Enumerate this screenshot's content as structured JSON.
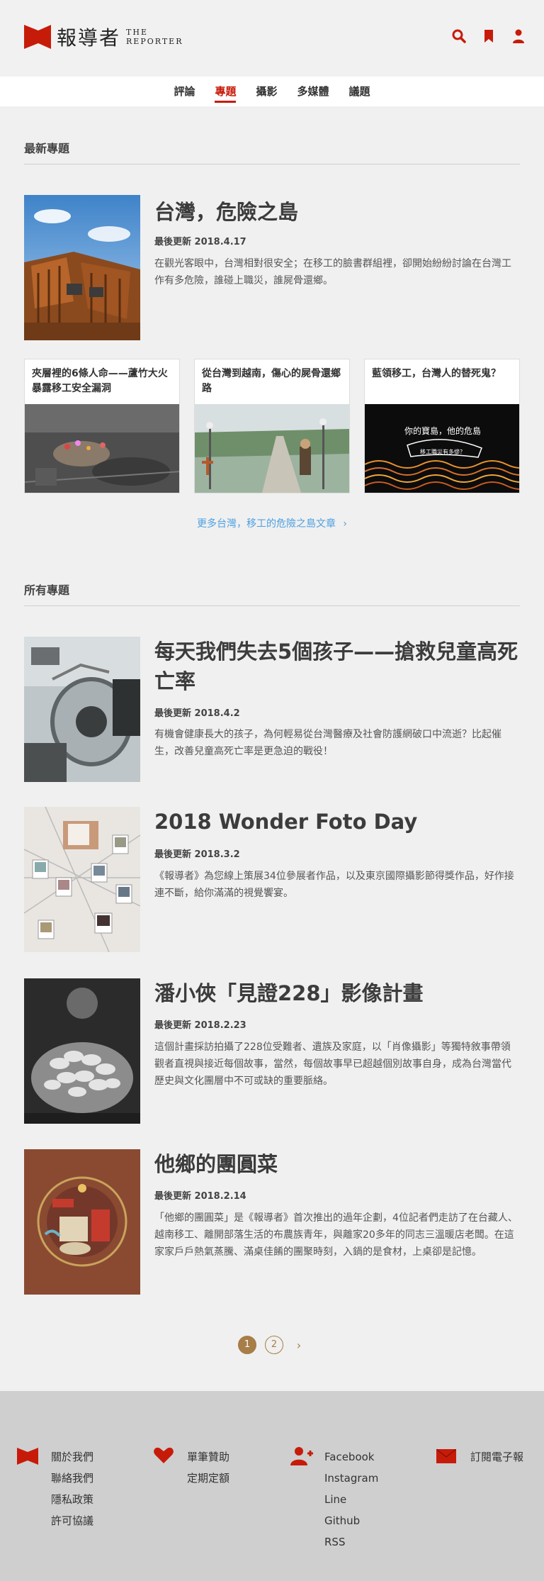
{
  "header": {
    "logo_cn": "報導者",
    "logo_en_line1": "THE",
    "logo_en_line2": "REPORTER",
    "colors": {
      "brand_red": "#c71b0a",
      "link_blue": "#4da0e0",
      "pager_gold": "#a77d48"
    },
    "icons": [
      "search-icon",
      "bookmark-icon",
      "user-icon"
    ]
  },
  "nav": {
    "items": [
      {
        "label": "評論"
      },
      {
        "label": "專題"
      },
      {
        "label": "攝影"
      },
      {
        "label": "多媒體"
      },
      {
        "label": "議題"
      }
    ],
    "active": "專題"
  },
  "latest": {
    "section_title": "最新專題",
    "featured": {
      "title": "台灣，危險之島",
      "date": "最後更新 2018.4.17",
      "description": "在觀光客眼中，台灣相對很安全；在移工的臉書群組裡，卻開始紛紛討論在台灣工作有多危險，誰碰上職災，誰屍骨還鄉。"
    },
    "cards": [
      {
        "title": "夾層裡的6條人命——蘆竹大火暴露移工安全漏洞"
      },
      {
        "title": "從台灣到越南，傷心的屍骨還鄉路"
      },
      {
        "title": "藍領移工，台灣人的替死鬼？",
        "image_text_1": "你的寶島，他的危島",
        "image_text_2": "移工職災有多慘？"
      }
    ],
    "more_link": "更多台灣，移工的危險之島文章"
  },
  "all": {
    "section_title": "所有專題",
    "articles": [
      {
        "title": "每天我們失去5個孩子——搶救兒童高死亡率",
        "date": "最後更新 2018.4.2",
        "description": "有機會健康長大的孩子，為何輕易從台灣醫療及社會防護網破口中流逝？比起催生，改善兒童高死亡率是更急迫的戰役！"
      },
      {
        "title": "2018 Wonder Foto Day",
        "date": "最後更新 2018.3.2",
        "description": "《報導者》為您線上策展34位參展者作品，以及東京國際攝影節得獎作品，好作接連不斷，給你滿滿的視覺饗宴。"
      },
      {
        "title": "潘小俠「見證228」影像計畫",
        "date": "最後更新 2018.2.23",
        "description": "這個計畫採訪拍攝了228位受難者、遺族及家庭，以「肖像攝影」等獨特敘事帶領觀者直視與接近每個故事，當然，每個故事早已超越個別故事自身，成為台灣當代歷史與文化團層中不可或缺的重要脈絡。"
      },
      {
        "title": "他鄉的團圓菜",
        "date": "最後更新 2018.2.14",
        "description": "「他鄉的團圓菜」是《報導者》首次推出的過年企劃，4位記者們走訪了在台藏人、越南移工、離開部落生活的布農族青年，與離家20多年的同志三溫暖店老闆。在這家家戶戶熱氣蒸騰、滿桌佳餚的團聚時刻，入鍋的是食材，上桌卻是記憶。"
      }
    ]
  },
  "pagination": {
    "pages": [
      "1",
      "2"
    ],
    "current": "1",
    "next": "›"
  },
  "footer": {
    "about": [
      "關於我們",
      "聯絡我們",
      "隱私政策",
      "許可協議"
    ],
    "donate": [
      "單筆贊助",
      "定期定額"
    ],
    "social": [
      "Facebook",
      "Instagram",
      "Line",
      "Github",
      "RSS"
    ],
    "subscribe": [
      "訂閱電子報"
    ]
  }
}
